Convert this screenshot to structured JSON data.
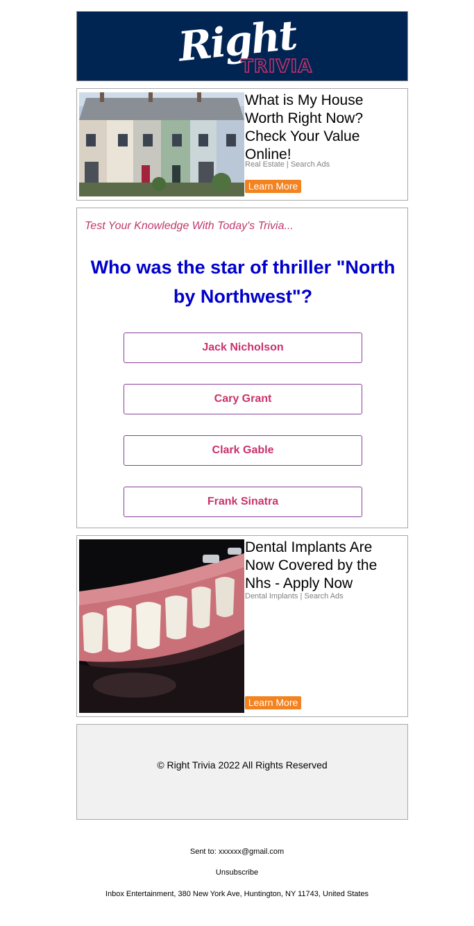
{
  "header": {
    "logo_word1": "Right",
    "logo_word2": "TRIVIA"
  },
  "ads": [
    {
      "title": "What is My House Worth Right Now? Check Your Value Online!",
      "source": "Real Estate | Search Ads",
      "button": "Learn More",
      "image_icon": "houses-photo"
    },
    {
      "title": "Dental Implants Are Now Covered by the Nhs - Apply Now",
      "source": "Dental Implants | Search Ads",
      "button": "Learn More",
      "image_icon": "dental-implant-photo"
    }
  ],
  "quiz": {
    "intro": "Test Your Knowledge With Today's Trivia...",
    "question": "Who was the star of thriller \"North by Northwest\"?",
    "answers": [
      "Jack Nicholson",
      "Cary Grant",
      "Clark Gable",
      "Frank Sinatra"
    ]
  },
  "footer": {
    "copyright": "© Right Trivia 2022 All Rights Reserved",
    "sent_to": "Sent to: xxxxxx@gmail.com",
    "unsubscribe": "Unsubscribe",
    "address": "Inbox Entertainment, 380 New York Ave, Huntington, NY 11743, United States"
  },
  "colors": {
    "header_bg": "#002553",
    "accent_pink": "#c8326b",
    "question_blue": "#0000cc",
    "button_orange": "#f38220"
  }
}
